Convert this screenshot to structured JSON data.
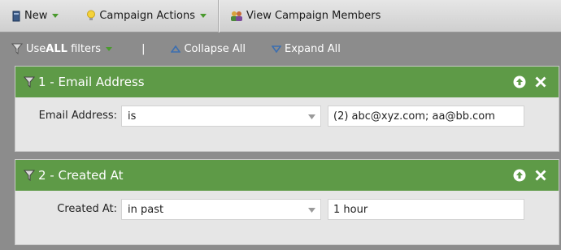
{
  "toolbar": {
    "new_label": "New",
    "campaign_actions_label": "Campaign Actions",
    "view_members_label": "View Campaign Members"
  },
  "filterbar": {
    "use_prefix": "Use ",
    "use_bold": "ALL",
    "use_suffix": " filters",
    "divider": "|",
    "collapse_label": "Collapse All",
    "expand_label": "Expand All"
  },
  "filters": [
    {
      "title": "1 - Email Address",
      "field_label": "Email Address:",
      "operator": "is",
      "value": "(2) abc@xyz.com; aa@bb.com"
    },
    {
      "title": "2 - Created At",
      "field_label": "Created At:",
      "operator": "in past",
      "value": "1 hour"
    }
  ],
  "icons": {
    "new": "new-document-icon",
    "campaign_actions": "lightbulb-icon",
    "view_members": "people-icon",
    "filter": "funnel-icon",
    "collapse": "triangle-up-icon",
    "expand": "triangle-down-icon",
    "move_up": "arrow-up-icon",
    "remove": "close-icon"
  },
  "colors": {
    "panel_header": "#5e9a47",
    "background": "#8c8c8c",
    "caret_green": "#4a9a2e"
  }
}
